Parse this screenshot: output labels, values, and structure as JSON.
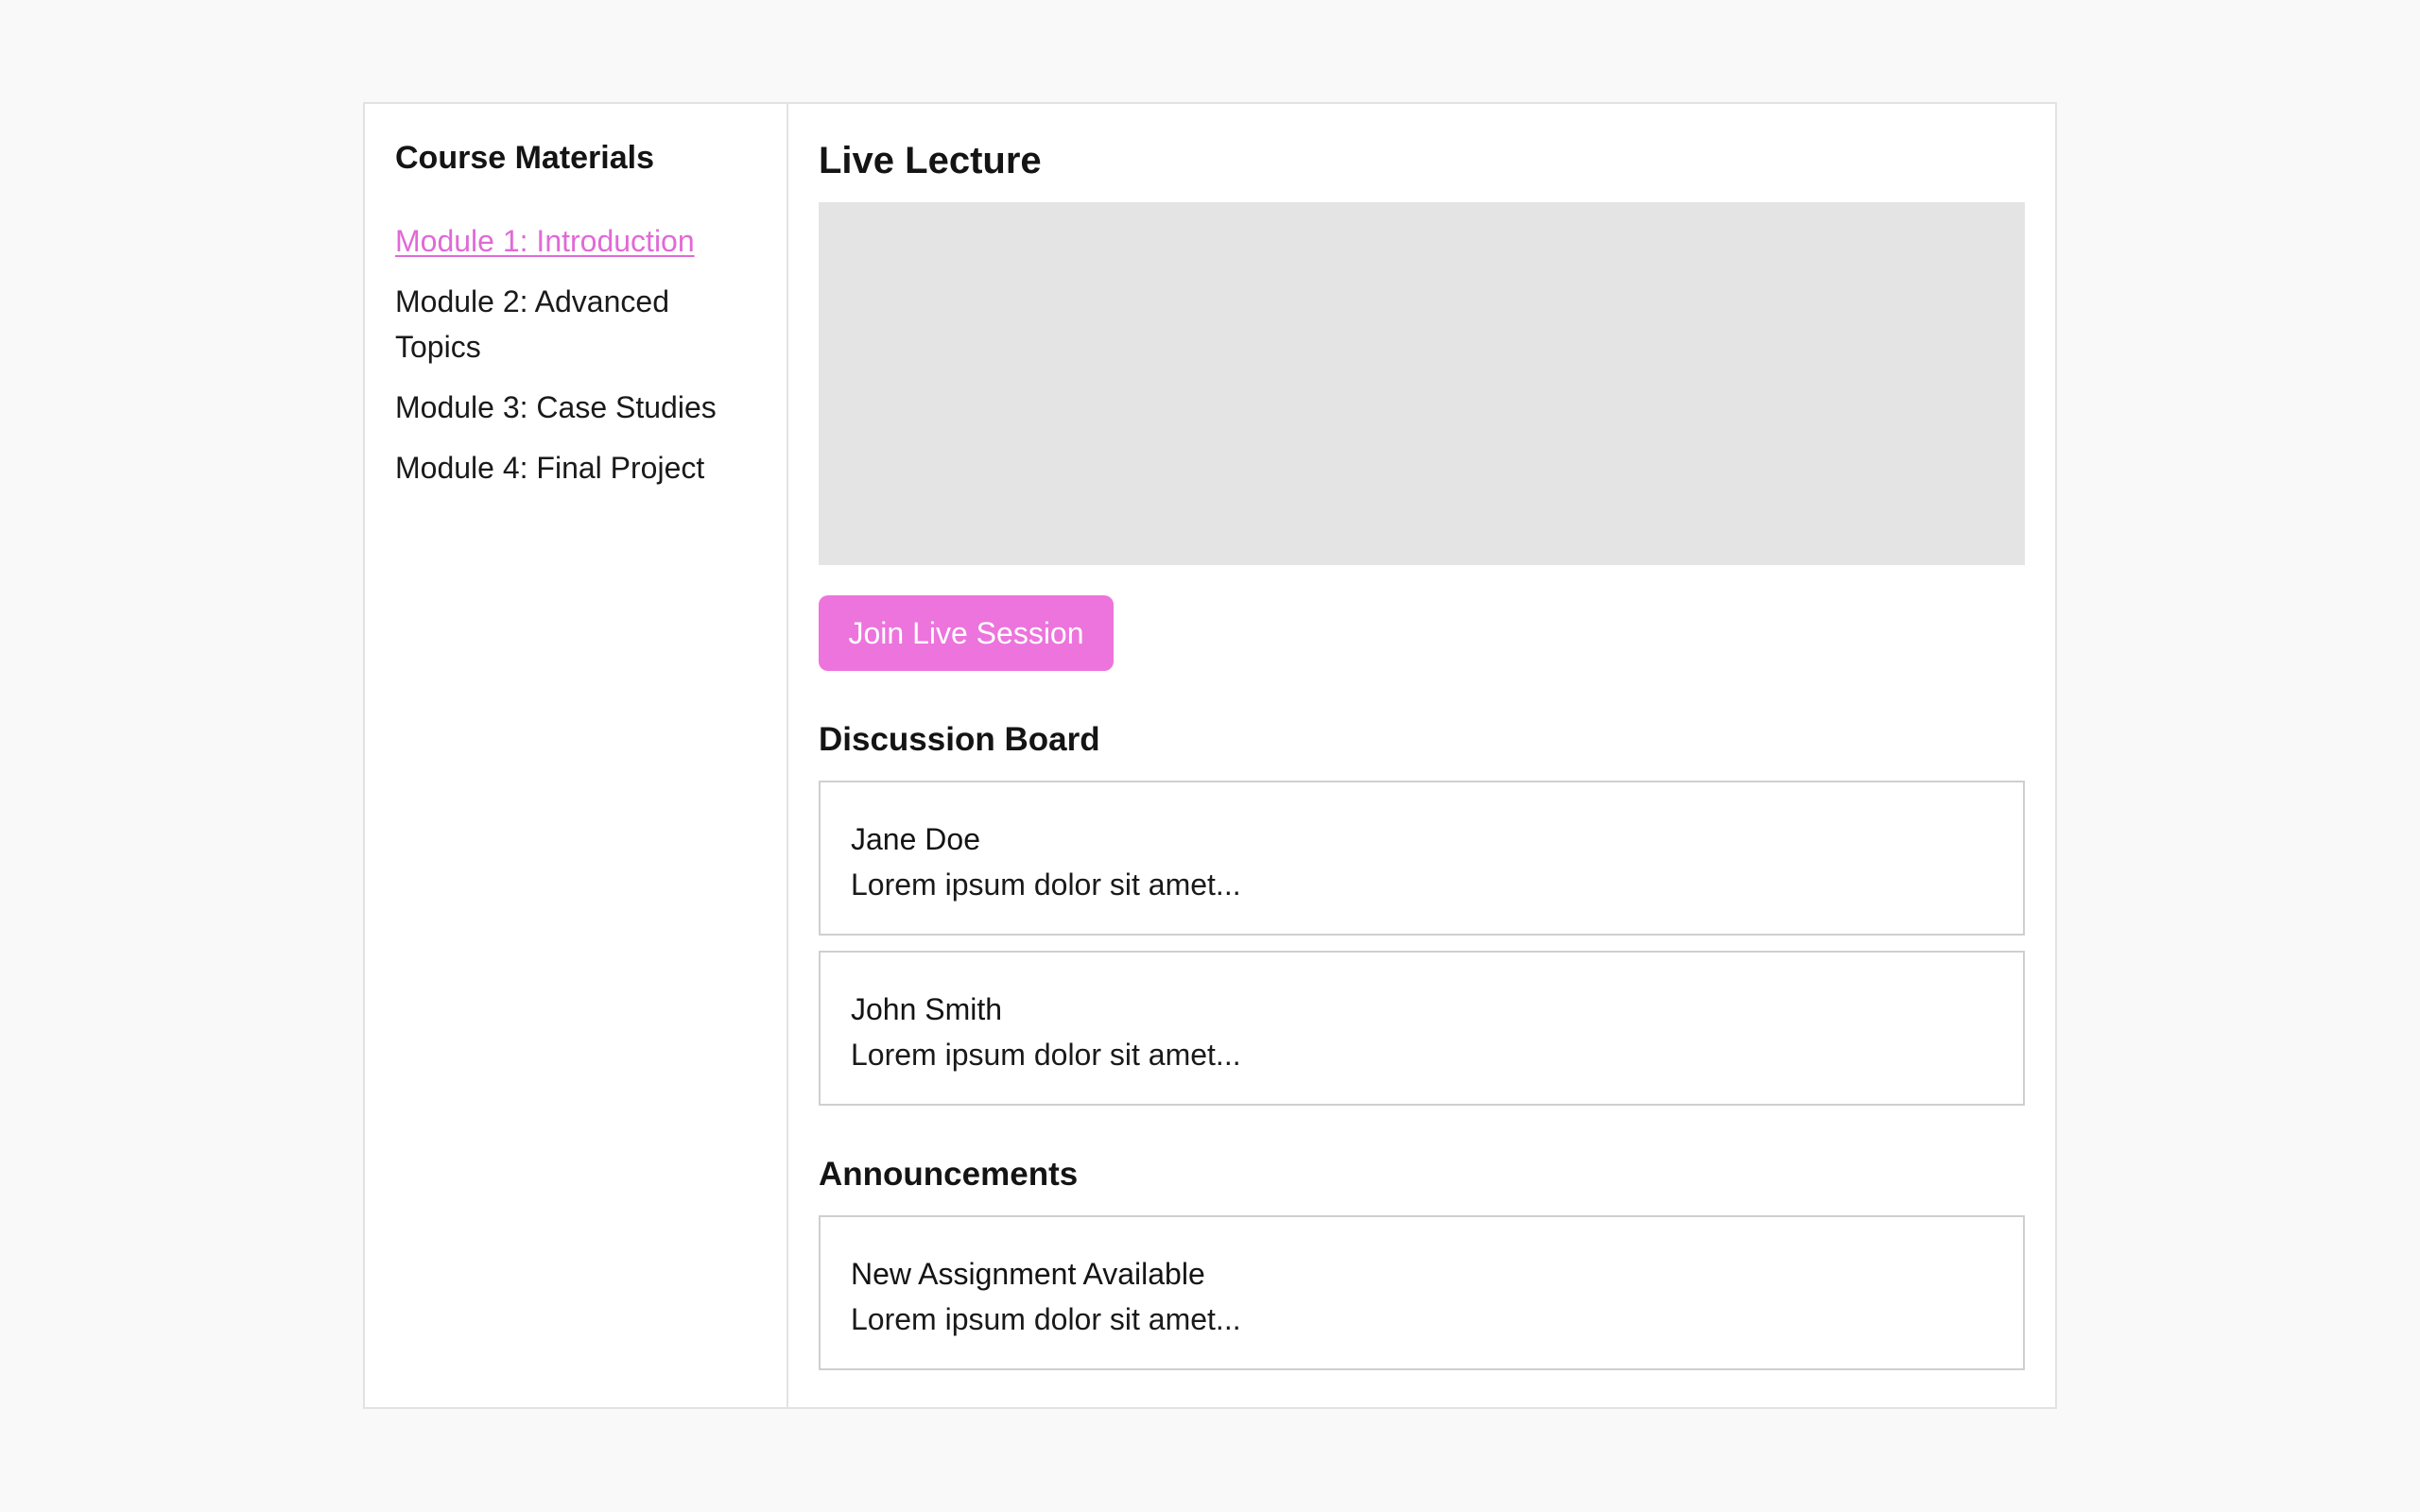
{
  "sidebar": {
    "title": "Course Materials",
    "items": [
      {
        "label": "Module 1: Introduction"
      },
      {
        "label": "Module 2: Advanced Topics"
      },
      {
        "label": "Module 3: Case Studies"
      },
      {
        "label": "Module 4: Final Project"
      }
    ],
    "active_index": 0
  },
  "live": {
    "title": "Live Lecture",
    "join_label": "Join Live Session"
  },
  "discussion": {
    "title": "Discussion Board",
    "posts": [
      {
        "author": "Jane Doe",
        "text": "Lorem ipsum dolor sit amet..."
      },
      {
        "author": "John Smith",
        "text": "Lorem ipsum dolor sit amet..."
      }
    ]
  },
  "announcements": {
    "title": "Announcements",
    "items": [
      {
        "title": "New Assignment Available",
        "text": "Lorem ipsum dolor sit amet..."
      }
    ]
  },
  "colors": {
    "accent": "#ec74dc",
    "link_active": "#e06ad6",
    "page_bg": "#f9f9f9",
    "video_placeholder": "#e4e4e4"
  }
}
